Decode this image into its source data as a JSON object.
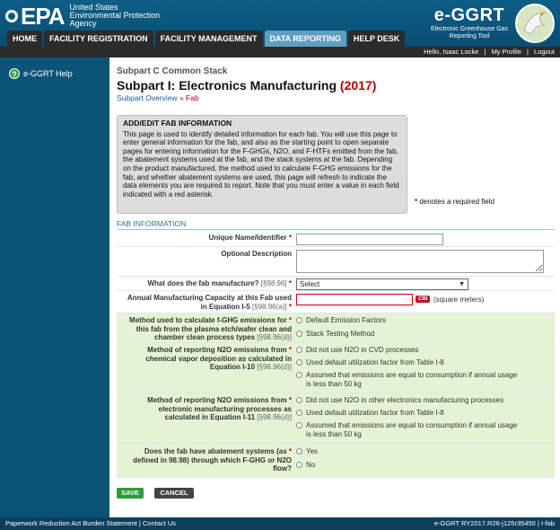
{
  "header": {
    "epa_logo_text": "EPA",
    "agency_lines": [
      "United States",
      "Environmental Protection",
      "Agency"
    ],
    "app_name": "e-GGRT",
    "app_subtitle_lines": [
      "Electronic Greenhouse Gas",
      "Reporting Tool"
    ]
  },
  "nav": {
    "tabs": [
      {
        "label": "HOME"
      },
      {
        "label": "FACILITY REGISTRATION"
      },
      {
        "label": "FACILITY MANAGEMENT"
      },
      {
        "label": "DATA REPORTING",
        "active": true
      },
      {
        "label": "HELP DESK"
      }
    ]
  },
  "userbar": {
    "greeting": "Hello, Isaac Locke",
    "sep1": "|",
    "my_profile": "My Profile",
    "sep2": "|",
    "logout": "Logout"
  },
  "sidebar": {
    "help_label": "e-GGRT Help",
    "help_icon": "question-circle-icon"
  },
  "page": {
    "subtitle": "Subpart C Common Stack",
    "title": "Subpart I: Electronics Manufacturing",
    "year": "(2017)",
    "breadcrumb_overview": "Subpart Overview",
    "breadcrumb_sep": "»",
    "breadcrumb_current": "Fab"
  },
  "info": {
    "heading": "ADD/EDIT FAB INFORMATION",
    "body": "This page is used to identify detailed information for each fab. You will use this page to enter general information for the fab, and also as the starting point to open separate pages for entering information for the F-GHGs, N2O, and F-HTFs emitted from the fab, the abatement systems used at the fab, and the stack systems at the fab. Depending on the product manufactured, the method used to calculate F-GHG emissions for the fab, and whether abatement systems are used, this page will refresh to indicate the data elements you are required to report. Note that you must enter a value in each field indicated with a red asterisk."
  },
  "required_note": {
    "star": "*",
    "text": "denotes a required field"
  },
  "section_label": "FAB INFORMATION",
  "form": {
    "unique_name": {
      "label": "Unique Name/Identifier",
      "star": "*",
      "value": ""
    },
    "optional_desc": {
      "label": "Optional Description",
      "value": ""
    },
    "fab_manufacture": {
      "label": "What does the fab manufacture?",
      "ref": "[§98.96]",
      "star": "*",
      "selected": "Select"
    },
    "capacity": {
      "label_line1": "Annual Manufacturing Capacity at this Fab used",
      "label_line2": "in Equation I-5",
      "ref": "[§98.96(a)]",
      "star": "*",
      "value": "",
      "cbi": "CBI",
      "unit": "(square meters)"
    },
    "fghg_method": {
      "label_lines": [
        "Method used to calculate f-GHG emissions for",
        "this fab from the plasma etch/wafer clean and",
        "chamber clean process types"
      ],
      "ref": "[§98.96(d)]",
      "star": "*",
      "options": [
        "Default Emission Factors",
        "Stack Testing Method"
      ]
    },
    "n2o_cvd": {
      "label_lines": [
        "Method of reporting N2O emissions from",
        "chemical vapor deposition as calculated in",
        "Equation I-10"
      ],
      "ref": "[§98.96(d)]",
      "star": "*",
      "options": [
        "Did not use N2O in CVD processes",
        "Used default utilization factor from Table I-8",
        "Assumed that emissions are equal to consumption if annual usage is less than 50 kg"
      ]
    },
    "n2o_other": {
      "label_lines": [
        "Method of reporting N2O emissions from",
        "electronic manufacturing processes as",
        "calculated in Equation I-11"
      ],
      "ref": "[§98.96(d)]",
      "star": "*",
      "options": [
        "Did not use N2O in other electronics manufacturing processes",
        "Used default utilization factor from Table I-8",
        "Assumed that emissions are equal to consumption if annual usage is less than 50 kg"
      ]
    },
    "abatement": {
      "label_lines": [
        "Does the fab have abatement systems (as",
        "defined in 98.98) through which F-GHG or N2O",
        "flow?"
      ],
      "star": "*",
      "options": [
        "Yes",
        "No"
      ]
    }
  },
  "buttons": {
    "save": "SAVE",
    "cancel": "CANCEL"
  },
  "footer": {
    "paperwork": "Paperwork Reduction Act Burden Statement",
    "sep": "|",
    "contact": "Contact Us",
    "version": "e-GGRT RY2017.R26-j125r35450",
    "sep2": "|",
    "code": "I-fab"
  },
  "colors": {
    "header_blue": "#0d5e86",
    "sidebar_blue": "#0c5378",
    "row_green": "#e4f3d4",
    "required_red": "#cc0000"
  }
}
